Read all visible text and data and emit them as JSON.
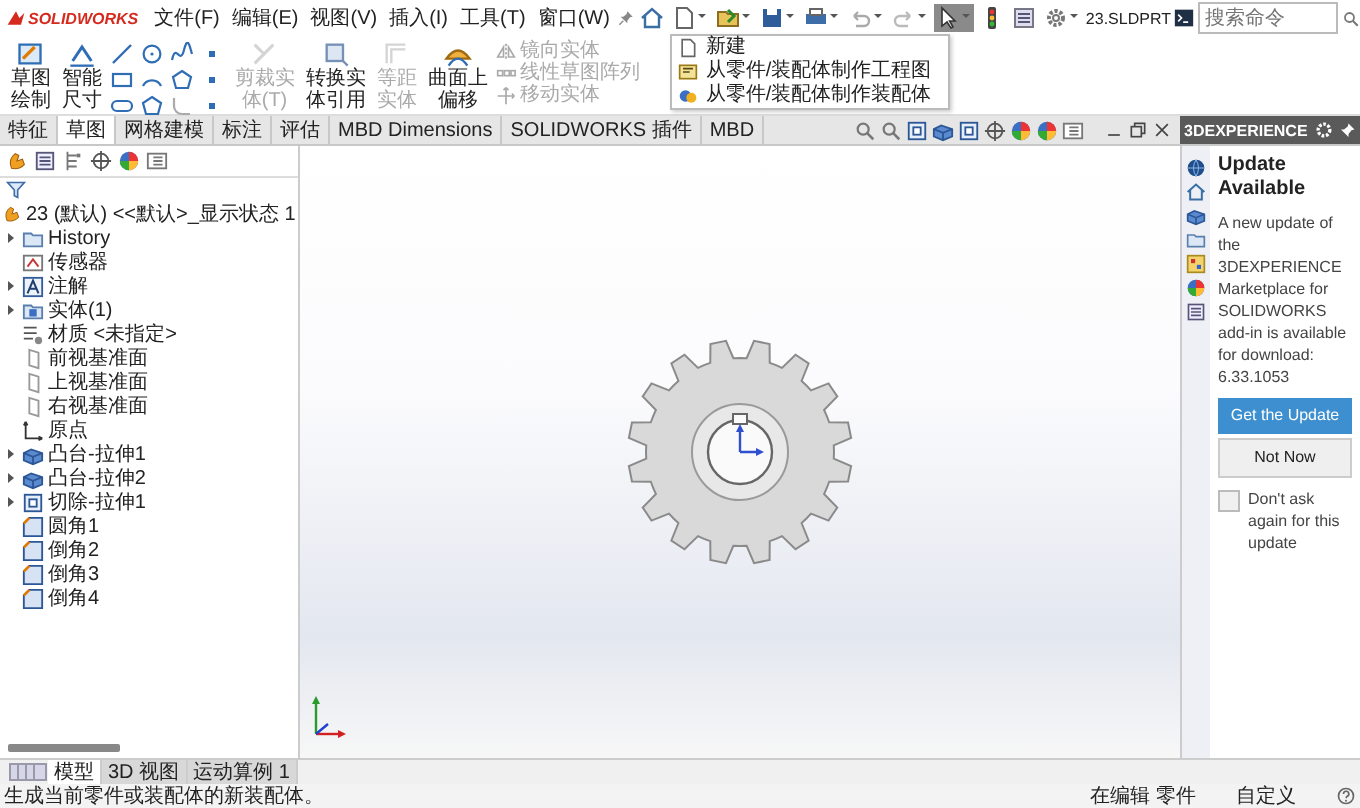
{
  "app": {
    "logo": "SOLIDWORKS"
  },
  "menu": [
    "文件(F)",
    "编辑(E)",
    "视图(V)",
    "插入(I)",
    "工具(T)",
    "窗口(W)"
  ],
  "document_title": "23.SLDPRT",
  "search": {
    "placeholder": "搜索命令"
  },
  "new_menu": [
    {
      "label": "新建"
    },
    {
      "label": "从零件/装配体制作工程图"
    },
    {
      "label": "从零件/装配体制作装配体"
    }
  ],
  "sketch_buttons": [
    {
      "label": "草图绘制",
      "disabled": false
    },
    {
      "label": "智能尺寸",
      "disabled": false
    }
  ],
  "entity_buttons": [
    {
      "label": "剪裁实体(T)",
      "disabled": true
    },
    {
      "label": "转换实体引用",
      "disabled": false
    },
    {
      "label": "等距实体",
      "disabled": true
    },
    {
      "label": "曲面上偏移",
      "disabled": false
    }
  ],
  "pattern_tools": [
    {
      "label": "镜向实体",
      "disabled": true
    },
    {
      "label": "线性草图阵列",
      "disabled": true
    },
    {
      "label": "移动实体",
      "disabled": true
    }
  ],
  "tabs": [
    {
      "label": "特征",
      "selected": false
    },
    {
      "label": "草图",
      "selected": true
    },
    {
      "label": "网格建模",
      "selected": false
    },
    {
      "label": "标注",
      "selected": false
    },
    {
      "label": "评估",
      "selected": false
    },
    {
      "label": "MBD Dimensions",
      "selected": false
    },
    {
      "label": "SOLIDWORKS 插件",
      "selected": false
    },
    {
      "label": "MBD",
      "selected": false
    }
  ],
  "tree": {
    "root": "23 (默认) <<默认>_显示状态 1",
    "items": [
      {
        "label": "History",
        "has_toggle": true
      },
      {
        "label": "传感器",
        "has_toggle": false
      },
      {
        "label": "注解",
        "has_toggle": true
      },
      {
        "label": "实体(1)",
        "has_toggle": true
      },
      {
        "label": "材质 <未指定>",
        "has_toggle": false
      },
      {
        "label": "前视基准面",
        "has_toggle": false
      },
      {
        "label": "上视基准面",
        "has_toggle": false
      },
      {
        "label": "右视基准面",
        "has_toggle": false
      },
      {
        "label": "原点",
        "has_toggle": false
      },
      {
        "label": "凸台-拉伸1",
        "has_toggle": true
      },
      {
        "label": "凸台-拉伸2",
        "has_toggle": true
      },
      {
        "label": "切除-拉伸1",
        "has_toggle": true
      },
      {
        "label": "圆角1",
        "has_toggle": false
      },
      {
        "label": "倒角2",
        "has_toggle": false
      },
      {
        "label": "倒角3",
        "has_toggle": false
      },
      {
        "label": "倒角4",
        "has_toggle": false
      }
    ]
  },
  "update_panel": {
    "header": "3DEXPERIENCE",
    "title": "Update Available",
    "message": "A new update of the 3DEXPERIENCE Marketplace for SOLIDWORKS add-in is available for download: 6.33.1053",
    "primary_button": "Get the Update",
    "secondary_button": "Not Now",
    "dont_ask": {
      "label": "Don't ask again for this update",
      "checked": false
    }
  },
  "bottom_tabs": [
    {
      "label": "模型",
      "selected": true
    },
    {
      "label": "3D 视图",
      "selected": false
    },
    {
      "label": "运动算例 1",
      "selected": false
    }
  ],
  "status_bar": {
    "message": "生成当前零件或装配体的新装配体。",
    "mode": "在编辑 零件",
    "units": "自定义"
  }
}
